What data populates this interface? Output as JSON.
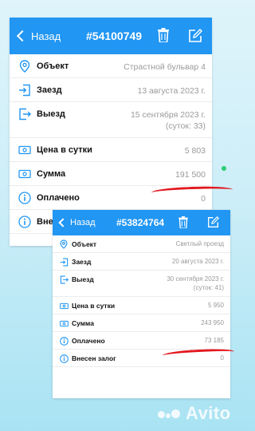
{
  "card1": {
    "header": {
      "back_label": "Назад",
      "title": "#54100749"
    },
    "rows": [
      {
        "label": "Объект",
        "value": "Страстной бульвар 4"
      },
      {
        "label": "Заезд",
        "value": "13 августа 2023 г."
      },
      {
        "label": "Выезд",
        "value": "15 сентября 2023 г.",
        "value2": "(суток: 33)"
      },
      {
        "label": "Цена в сутки",
        "value": "5 803"
      },
      {
        "label": "Сумма",
        "value": "191 500"
      },
      {
        "label": "Оплачено",
        "value": "0"
      },
      {
        "label": "Внесен",
        "value": ""
      }
    ]
  },
  "card2": {
    "header": {
      "back_label": "Назад",
      "title": "#53824764"
    },
    "rows": [
      {
        "label": "Объект",
        "value": "Светлый проезд"
      },
      {
        "label": "Заезд",
        "value": "20 августа 2023 г."
      },
      {
        "label": "Выезд",
        "value": "30 сентября 2023 г.",
        "value2": "(суток: 41)"
      },
      {
        "label": "Цена в сутки",
        "value": "5 950"
      },
      {
        "label": "Сумма",
        "value": "243 950"
      },
      {
        "label": "Оплачено",
        "value": "73 185"
      },
      {
        "label": "Внесен залог",
        "value": "0"
      }
    ]
  },
  "watermark": "Avito",
  "colors": {
    "header": "#2196f3",
    "icon": "#2196f3",
    "annotation": "#e3191f",
    "dot": "#2ecc71"
  },
  "icons": [
    "chevron-left-icon",
    "trash-icon",
    "edit-icon",
    "location-pin-icon",
    "checkin-icon",
    "checkout-icon",
    "money-icon",
    "info-icon"
  ]
}
